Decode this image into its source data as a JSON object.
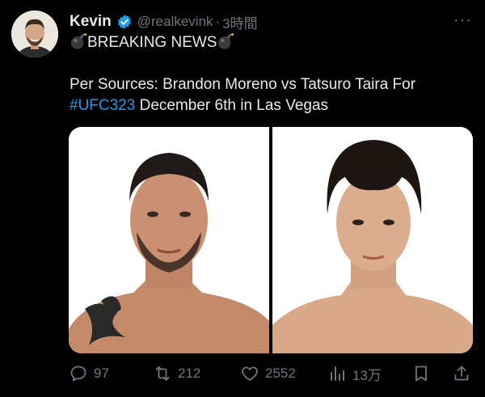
{
  "tweet": {
    "author_name": "Kevin",
    "handle": "@realkevink",
    "separator": "·",
    "time": "3時間",
    "more_label": "···",
    "headline": "BREAKING NEWS",
    "body_prefix": "Per Sources: Brandon Moreno vs Tatsuro Taira For",
    "hashtag": "#UFC323",
    "body_suffix": "December 6th in Las Vegas"
  },
  "actions": {
    "replies": "97",
    "reposts": "212",
    "likes": "2552",
    "views": "13万"
  },
  "colors": {
    "background": "#000000",
    "text": "#e7e9ea",
    "muted": "#71767b",
    "link": "#1d9bf0",
    "verified": "#1d9bf0"
  }
}
